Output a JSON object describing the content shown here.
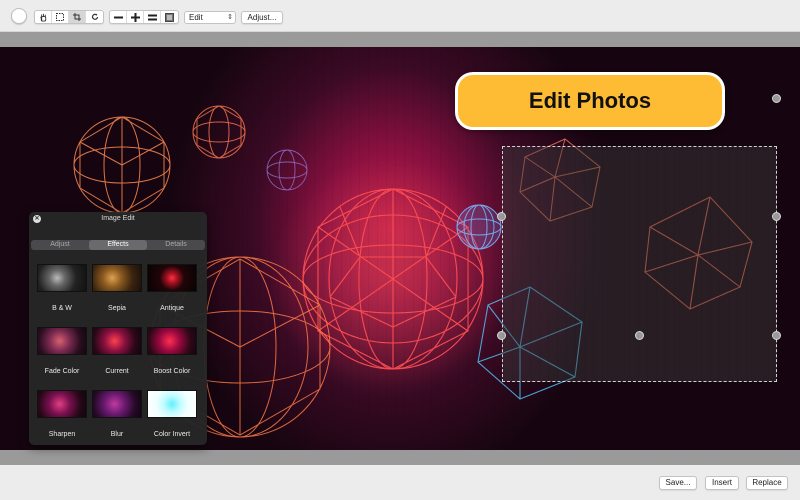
{
  "toolbar": {
    "tool_icons": [
      "hand-icon",
      "select-rect-icon",
      "crop-icon",
      "rotate-icon"
    ],
    "zoom_icons": [
      "zoom-out-icon",
      "zoom-in-icon",
      "actual-size-icon",
      "fit-icon"
    ],
    "mode_select": "Edit",
    "adjust_label": "Adjust..."
  },
  "banner": {
    "text": "Edit Photos"
  },
  "panel": {
    "title": "Image Edit",
    "tabs": [
      {
        "label": "Adjust",
        "active": false
      },
      {
        "label": "Effects",
        "active": true
      },
      {
        "label": "Details",
        "active": false
      }
    ],
    "effects": [
      {
        "label": "B & W"
      },
      {
        "label": "Sepia"
      },
      {
        "label": "Antique"
      },
      {
        "label": "Fade Color"
      },
      {
        "label": "Current"
      },
      {
        "label": "Boost Color"
      },
      {
        "label": "Sharpen"
      },
      {
        "label": "Blur"
      },
      {
        "label": "Color Invert"
      }
    ]
  },
  "footer": {
    "save_label": "Save...",
    "insert_label": "Insert",
    "replace_label": "Replace"
  },
  "colors": {
    "accent": "#fdbc33",
    "canvas_glow": "#c2204a"
  }
}
